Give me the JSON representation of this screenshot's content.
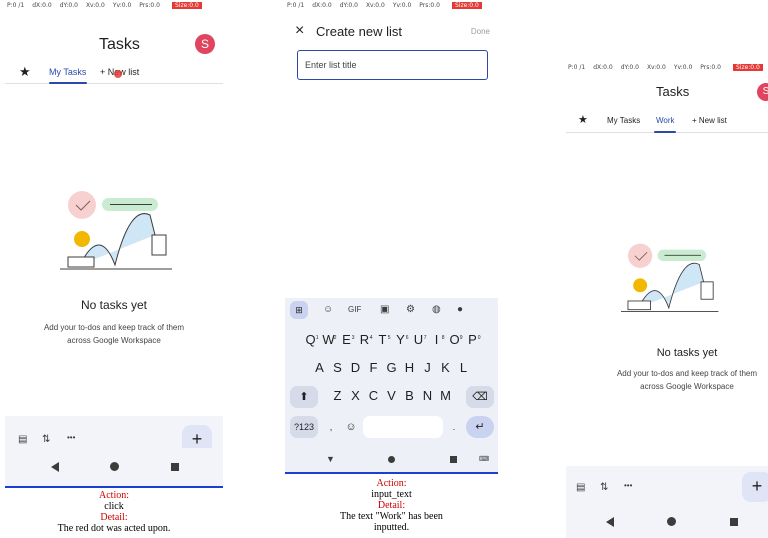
{
  "status_bar": {
    "p": "P:0 /1",
    "dx": "dX:0.0",
    "dy": "dY:0.0",
    "xv": "Xv:0.0",
    "yv": "Yv:0.0",
    "prs": "Prs:0.0",
    "size": "Size:0.0"
  },
  "panel1": {
    "app_title": "Tasks",
    "avatar_letter": "S",
    "tabs": {
      "my_tasks": "My Tasks",
      "new_list": "+ New list"
    },
    "empty_title": "No tasks yet",
    "empty_line1": "Add your to-dos and keep track of them",
    "empty_line2": "across Google Workspace",
    "fab": "+",
    "more_icon": "•••",
    "caption_action_label": "Action:",
    "caption_action": "click",
    "caption_detail_label": "Detail:",
    "caption_detail": "The red dot was acted upon."
  },
  "panel2": {
    "close_icon": "×",
    "title": "Create new list",
    "done": "Done",
    "input_placeholder": "Enter list title",
    "keyboard": {
      "row1": [
        "Q",
        "W",
        "E",
        "R",
        "T",
        "Y",
        "U",
        "I",
        "O",
        "P"
      ],
      "row1_digits": [
        "1",
        "2",
        "3",
        "4",
        "5",
        "6",
        "7",
        "8",
        "9",
        "0"
      ],
      "row2": [
        "A",
        "S",
        "D",
        "F",
        "G",
        "H",
        "J",
        "K",
        "L"
      ],
      "row3": [
        "Z",
        "X",
        "C",
        "V",
        "B",
        "N",
        "M"
      ],
      "symbols_key": "?123",
      "comma": ",",
      "period": ".",
      "gif": "GIF"
    },
    "caption_action_label": "Action:",
    "caption_action": "input_text",
    "caption_detail_label": "Detail:",
    "caption_detail_line1": "The text \"Work\" has been",
    "caption_detail_line2": "inputted."
  },
  "panel3": {
    "app_title": "Tasks",
    "avatar_letter": "S",
    "tabs": {
      "my_tasks": "My Tasks",
      "work": "Work",
      "new_list": "+ New list"
    },
    "empty_title": "No tasks yet",
    "empty_line1": "Add your to-dos and keep track of them",
    "empty_line2": "across Google Workspace",
    "fab": "+",
    "more_icon": "•••"
  },
  "colors": {
    "accent": "#2b4aa8",
    "avatar": "#e0445f",
    "caption_label": "#d00000",
    "divider": "#1a3fd1"
  }
}
